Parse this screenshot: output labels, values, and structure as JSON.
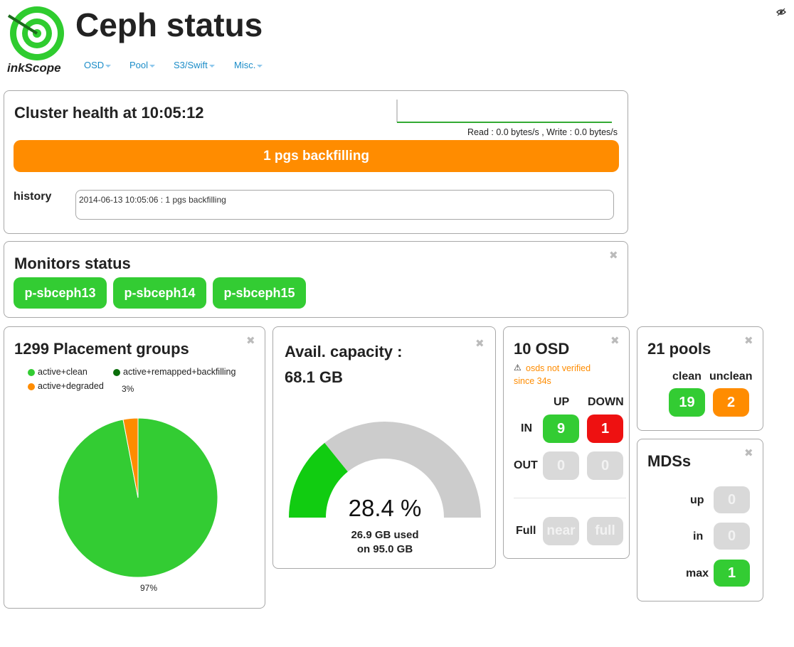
{
  "app": {
    "logo_text": "inkScope",
    "title": "Ceph status"
  },
  "nav": [
    {
      "label": "OSD"
    },
    {
      "label": "Pool"
    },
    {
      "label": "S3/Swift"
    },
    {
      "label": "Misc."
    }
  ],
  "health": {
    "title": "Cluster health at 10:05:12",
    "io_text": "Read : 0.0 bytes/s , Write : 0.0 bytes/s",
    "status": "1 pgs backfilling",
    "status_color": "#ff8c00",
    "history_label": "history",
    "history_text": "2014-06-13 10:05:06 : 1 pgs backfilling"
  },
  "monitors": {
    "title": "Monitors status",
    "items": [
      "p-sbceph13",
      "p-sbceph14",
      "p-sbceph15"
    ]
  },
  "pgs": {
    "title": "1299 Placement groups",
    "legend": [
      {
        "label": "active+clean",
        "color": "#33cc33"
      },
      {
        "label": "active+remapped+backfilling",
        "color": "#0a6e0a"
      },
      {
        "label": "active+degraded",
        "color": "#ff8c00"
      }
    ],
    "slice_labels": {
      "small": "3%",
      "large": "97%"
    }
  },
  "chart_data": {
    "type": "pie",
    "categories": [
      "active+clean",
      "active+remapped+backfilling",
      "active+degraded"
    ],
    "values": [
      97,
      0,
      3
    ]
  },
  "capacity": {
    "title_line1": "Avail. capacity :",
    "title_line2": "68.1 GB",
    "percent": "28.4 %",
    "used_fraction": 0.284,
    "used_line": "26.9 GB used",
    "total_line": "on 95.0 GB"
  },
  "osd": {
    "title": "10 OSD",
    "warning": "osds not verified",
    "warning_since": "since 34s",
    "col_up": "UP",
    "col_down": "DOWN",
    "row_in": "IN",
    "row_out": "OUT",
    "row_full": "Full",
    "in_up": "9",
    "in_down": "1",
    "out_up": "0",
    "out_down": "0",
    "near": "near",
    "full": "full"
  },
  "pools": {
    "title": "21 pools",
    "clean_label": "clean",
    "unclean_label": "unclean",
    "clean": "19",
    "unclean": "2"
  },
  "mds": {
    "title": "MDSs",
    "up_label": "up",
    "in_label": "in",
    "max_label": "max",
    "up": "0",
    "in": "0",
    "max": "1"
  }
}
